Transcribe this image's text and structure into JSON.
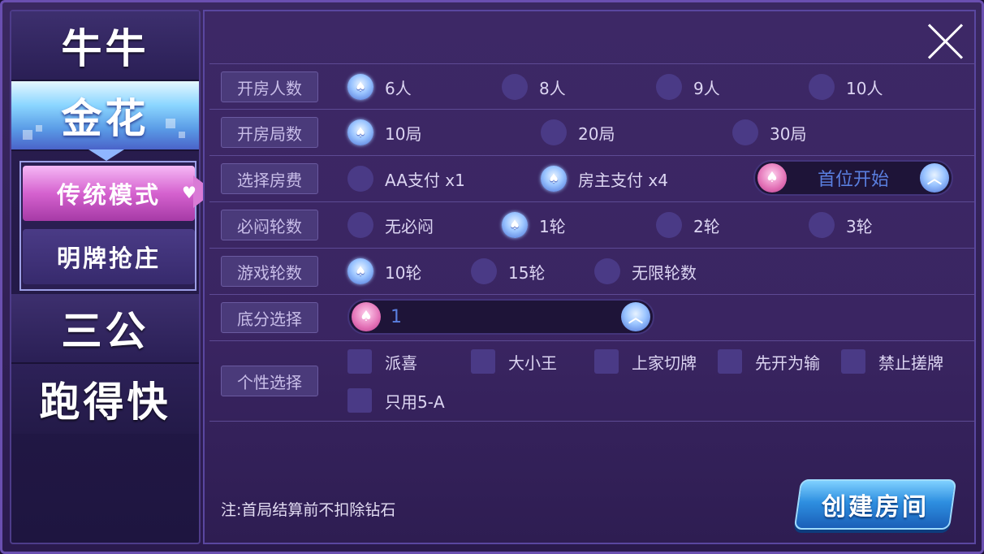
{
  "sidebar": {
    "games": [
      {
        "label": "牛牛",
        "active": false
      },
      {
        "label": "金花",
        "active": true
      },
      {
        "label": "三公",
        "active": false
      },
      {
        "label": "跑得快",
        "active": false
      }
    ],
    "modes": [
      {
        "label": "传统模式",
        "active": true
      },
      {
        "label": "明牌抢庄",
        "active": false
      }
    ]
  },
  "settings": {
    "players": {
      "label": "开房人数",
      "options": [
        "6人",
        "8人",
        "9人",
        "10人"
      ],
      "selected": 0
    },
    "rounds": {
      "label": "开房局数",
      "options": [
        "10局",
        "20局",
        "30局"
      ],
      "selected": 0
    },
    "fee": {
      "label": "选择房费",
      "options": [
        "AA支付 x1",
        "房主支付 x4"
      ],
      "selected": 1,
      "dropdown_value": "首位开始"
    },
    "blind": {
      "label": "必闷轮数",
      "options": [
        "无必闷",
        "1轮",
        "2轮",
        "3轮"
      ],
      "selected": 1
    },
    "game_rounds": {
      "label": "游戏轮数",
      "options": [
        "10轮",
        "15轮",
        "无限轮数"
      ],
      "selected": 0
    },
    "base_score": {
      "label": "底分选择",
      "dropdown_value": "1"
    },
    "custom": {
      "label": "个性选择",
      "options": [
        "派喜",
        "大小王",
        "上家切牌",
        "先开为输",
        "禁止搓牌",
        "只用5-A"
      ]
    }
  },
  "footer": {
    "note": "注:首局结算前不扣除钻石",
    "create_label": "创建房间"
  },
  "colors": {
    "accent_blue": "#4a6fd6",
    "accent_pink": "#d562cf",
    "panel": "#3a2562"
  }
}
